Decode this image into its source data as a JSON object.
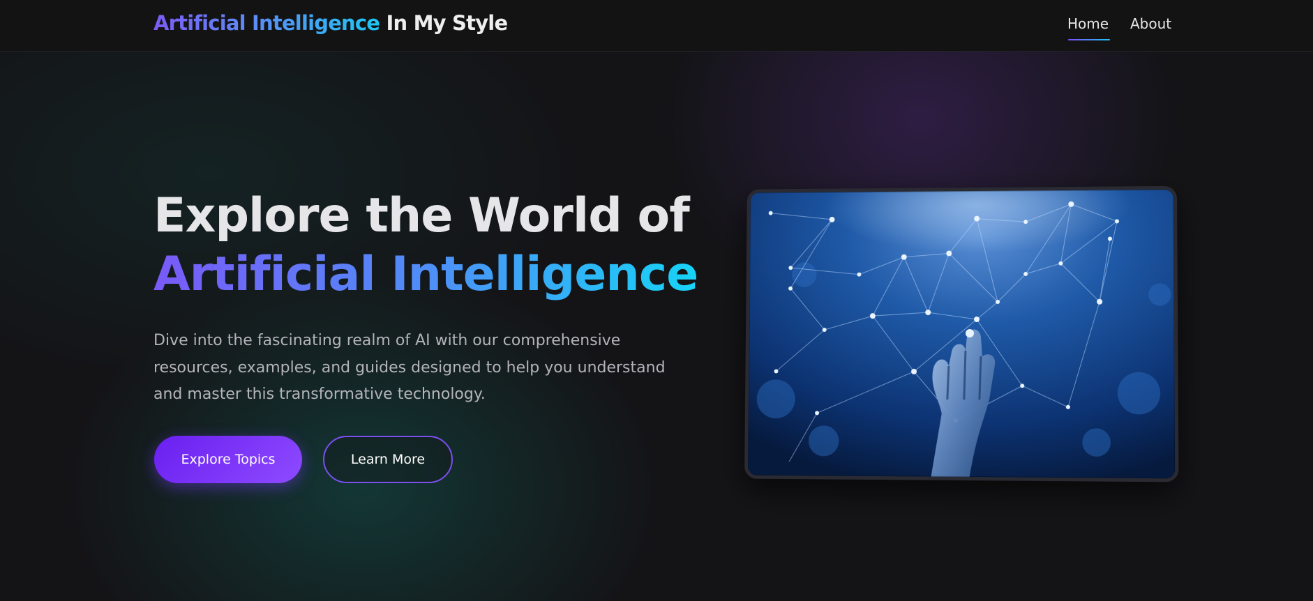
{
  "header": {
    "brand_highlight": "Artificial Intelligence",
    "brand_rest": "In My Style",
    "nav": [
      {
        "label": "Home",
        "active": true
      },
      {
        "label": "About",
        "active": false
      }
    ]
  },
  "hero": {
    "title_line1": "Explore the World of",
    "title_line2": "Artificial Intelligence",
    "description": "Dive into the fascinating realm of AI with our comprehensive resources, examples, and guides designed to help you understand and master this transformative technology.",
    "primary_button": "Explore Topics",
    "secondary_button": "Learn More",
    "image_icon": "robot-hand-network-illustration"
  },
  "colors": {
    "background": "#141417",
    "accent_purple": "#7c4dff",
    "accent_cyan": "#17d3f7",
    "text_primary": "#e6e6e8",
    "text_secondary": "#b4b4ba"
  }
}
